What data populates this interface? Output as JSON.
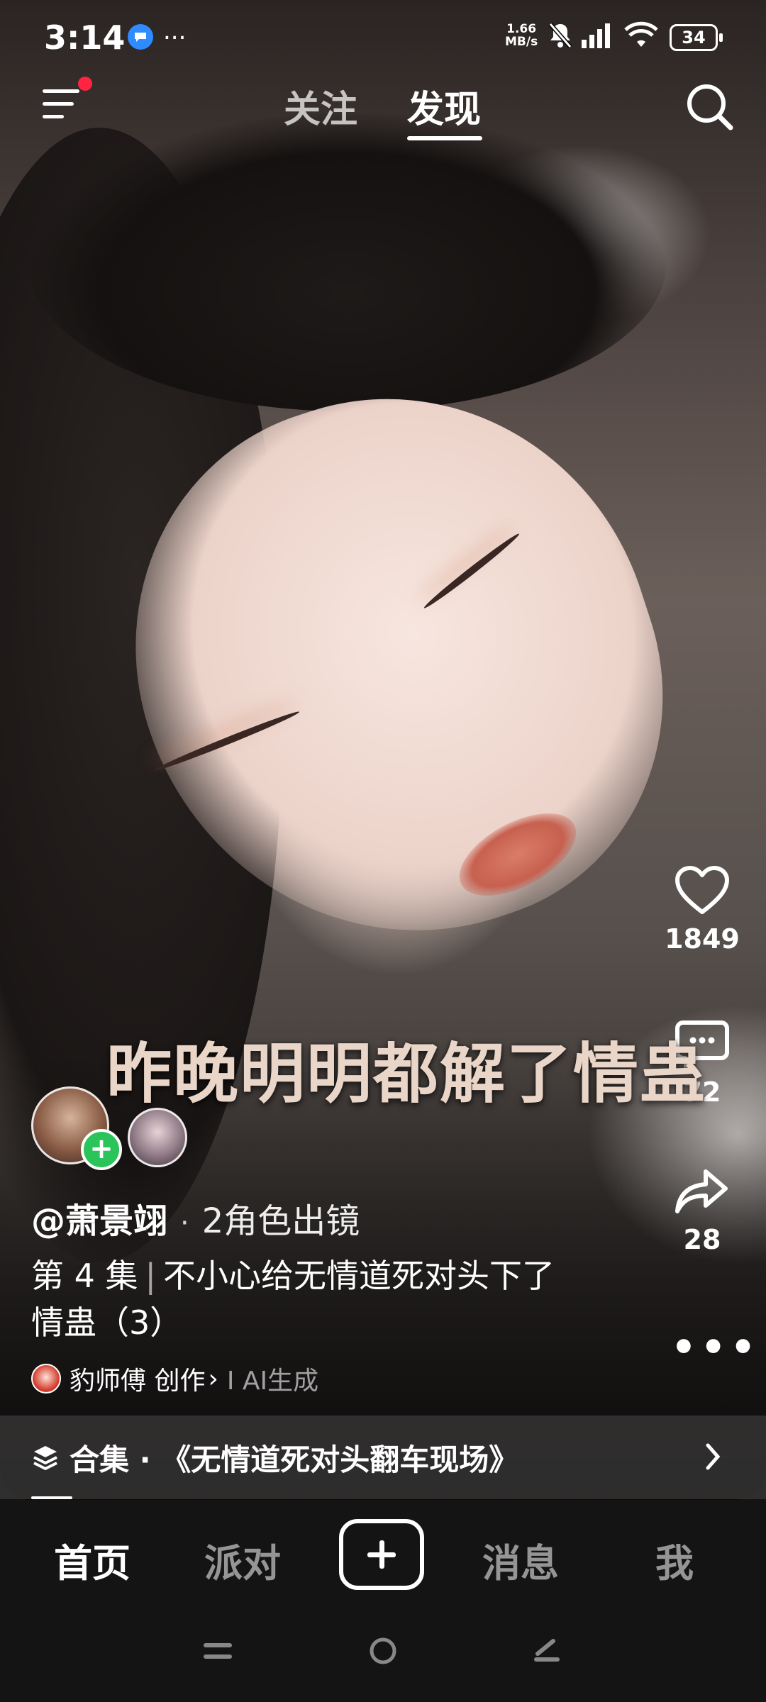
{
  "status_bar": {
    "time": "3:14",
    "notification": "...",
    "net_speed_value": "1.66",
    "net_speed_unit": "MB/s",
    "battery": "34"
  },
  "top_nav": {
    "tabs": [
      {
        "label": "关注",
        "active": false
      },
      {
        "label": "发现",
        "active": true
      }
    ],
    "menu_has_badge": true,
    "badge_color": "#ff2442"
  },
  "video": {
    "caption": "昨晚明明都解了情蛊",
    "author": "@萧景翊",
    "separator": "·",
    "roles": "2角色出镜",
    "episode": "第 4 集",
    "episode_divider": "|",
    "title": "不小心给无情道死对头下了情蛊（3）",
    "creator": "豹师傅 创作",
    "creator_chevron": "›",
    "ai_label": "I AI生成",
    "follow_symbol": "+"
  },
  "actions": {
    "likes": "1849",
    "comments": "72",
    "shares": "28",
    "more": "•••"
  },
  "collection": {
    "label": "合集 · 《无情道死对头翻车现场》",
    "chevron": "›"
  },
  "bottom_tabs": [
    {
      "label": "首页",
      "active": true
    },
    {
      "label": "派对",
      "active": false
    },
    {
      "label": "消息",
      "active": false
    },
    {
      "label": "我",
      "active": false
    }
  ],
  "colors": {
    "follow_green": "#2bc45a",
    "message_blue": "#2f8cff"
  }
}
